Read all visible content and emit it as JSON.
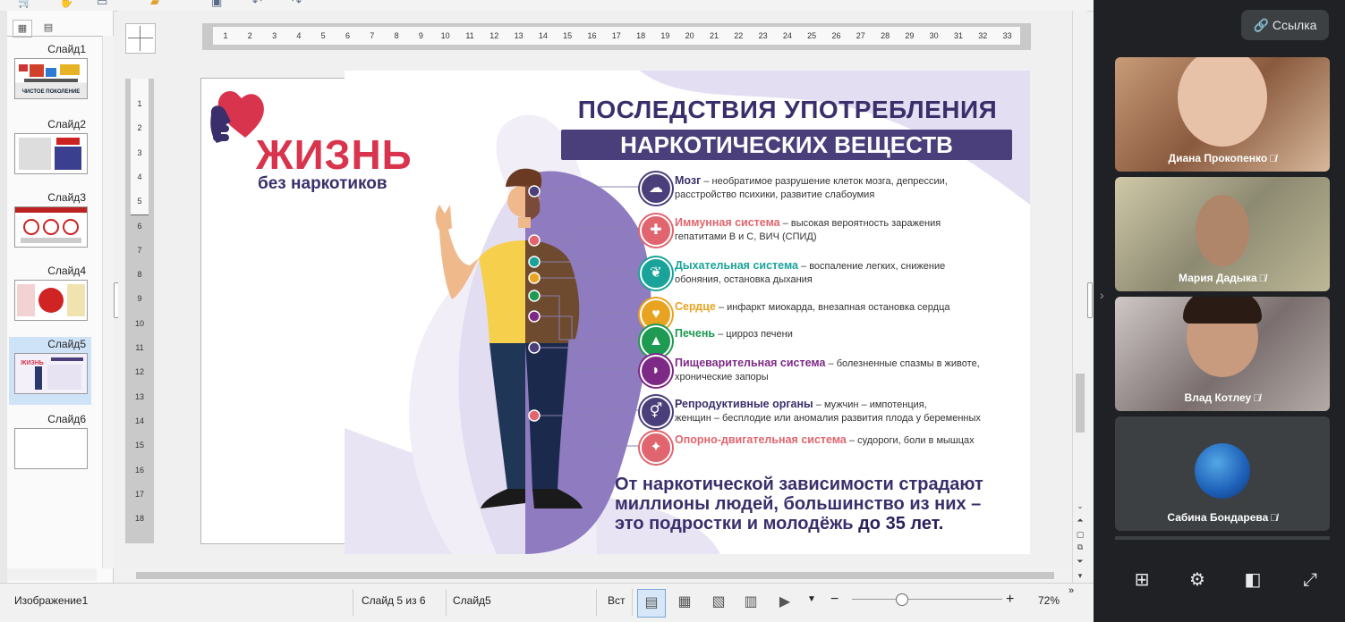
{
  "slides_panel": {
    "items": [
      {
        "label": "Слайд1",
        "thumb_title": "ЧИСТОЕ ПОКОЛЕНИЕ"
      },
      {
        "label": "Слайд2"
      },
      {
        "label": "Слайд3"
      },
      {
        "label": "Слайд4"
      },
      {
        "label": "Слайд5",
        "thumb_title": "ЖИЗНЬ"
      },
      {
        "label": "Слайд6"
      }
    ]
  },
  "ruler": {
    "h_numbers": [
      "1",
      "2",
      "3",
      "4",
      "5",
      "6",
      "7",
      "8",
      "9",
      "10",
      "11",
      "12",
      "13",
      "14",
      "15",
      "16",
      "17",
      "18",
      "19",
      "20",
      "21",
      "22",
      "23",
      "24",
      "25",
      "26",
      "27",
      "28",
      "29",
      "30",
      "31",
      "32",
      "33"
    ],
    "v_numbers": [
      "1",
      "2",
      "3",
      "4",
      "5",
      "6",
      "7",
      "8",
      "9",
      "10",
      "11",
      "12",
      "13",
      "14",
      "15",
      "16",
      "17",
      "18"
    ]
  },
  "poster": {
    "logo_big": "ЖИЗНЬ",
    "logo_small": "без наркотиков",
    "title_line1": "ПОСЛЕДСТВИЯ УПОТРЕБЛЕНИЯ",
    "title_line2": "НАРКОТИЧЕСКИХ ВЕЩЕСТВ",
    "items": [
      {
        "head": "Мозг",
        "text1": " – необратимое разрушение клеток мозга, депрессии,",
        "text2": "расстройство психики, развитие слабоумия",
        "color": "#3b2f6b",
        "icon_color": "#4a3f7a",
        "glyph": "☁"
      },
      {
        "head": "Иммунная система",
        "text1": " – высокая вероятность заражения",
        "text2": "гепатитами В и С, ВИЧ (СПИД)",
        "color": "#e0656f",
        "icon_color": "#e0656f",
        "glyph": "✚"
      },
      {
        "head": "Дыхательная система",
        "text1": " – воспаление легких, снижение",
        "text2": "обоняния, остановка дыхания",
        "color": "#1aa39a",
        "icon_color": "#1aa39a",
        "glyph": "❦"
      },
      {
        "head": "Сердце",
        "text1": " – инфаркт миокарда, внезапная остановка сердца",
        "text2": "",
        "color": "#e8a421",
        "icon_color": "#e8a421",
        "glyph": "♥"
      },
      {
        "head": "Печень",
        "text1": " – цирроз печени",
        "text2": "",
        "color": "#1e9a52",
        "icon_color": "#1e9a52",
        "glyph": "▲"
      },
      {
        "head": "Пищеварительная система",
        "text1": " – болезненные спазмы в животе,",
        "text2": "хронические запоры",
        "color": "#7d2a86",
        "icon_color": "#7d2a86",
        "glyph": "◗"
      },
      {
        "head": "Репродуктивные органы",
        "text1": " – мужчин – импотенция,",
        "text2": "женщин – бесплодие или аномалия развития плода у беременных",
        "color": "#3b2f6b",
        "icon_color": "#4a3f7a",
        "glyph": "⚥"
      },
      {
        "head": "Опорно-двигательная система",
        "text1": " – судороги, боли в мышцах",
        "text2": "",
        "color": "#e0656f",
        "icon_color": "#e0656f",
        "glyph": "✦"
      }
    ],
    "bottom_line1": "От наркотической зависимости страдают",
    "bottom_line2": "миллионы людей, большинство из них –",
    "bottom_line3": "это подростки и молодёжь ",
    "bottom_bold": "до 35 лет."
  },
  "status": {
    "object": "Изображение1",
    "slide_of": "Слайд 5 из 6",
    "slide_name": "Слайд5",
    "insert_mode": "Вст",
    "zoom": "72%",
    "zoom_fraction": 0.33
  },
  "meet": {
    "link_label": "Ссылка",
    "participants": [
      {
        "name": "Диана Прокопенко"
      },
      {
        "name": "Мария Дадыка"
      },
      {
        "name": "Влад Котлеу"
      },
      {
        "name": "Сабина Бондарева"
      }
    ]
  }
}
